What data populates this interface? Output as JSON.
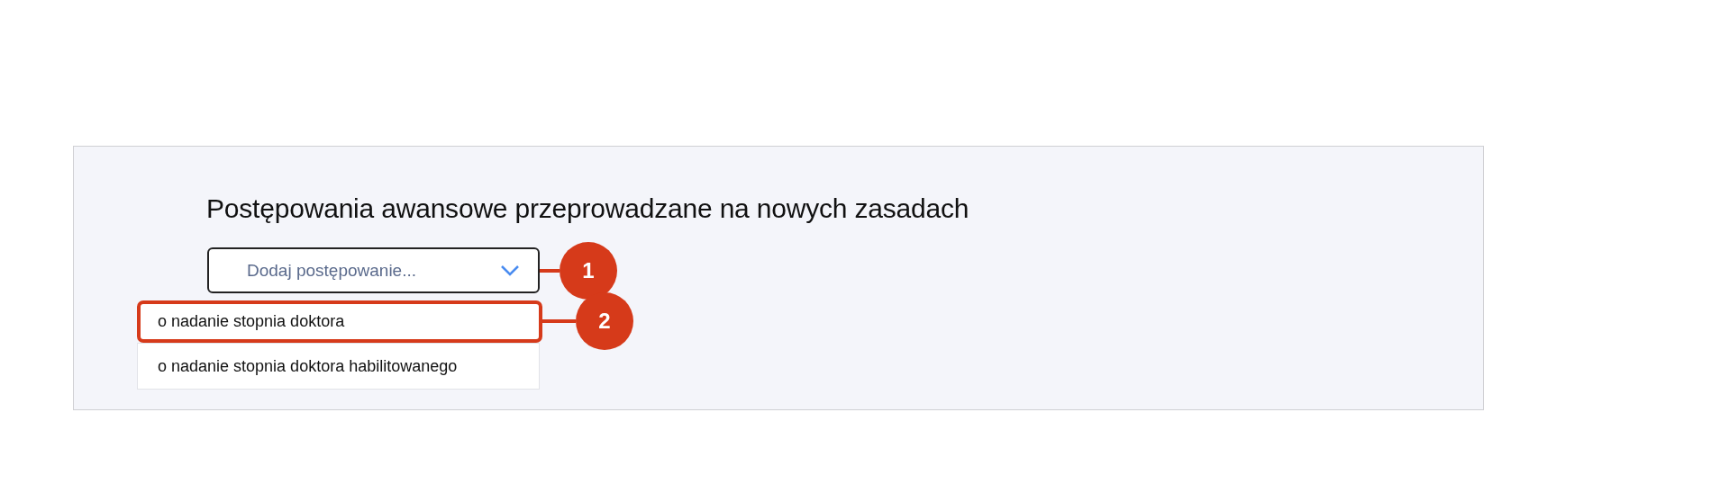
{
  "title": "Postępowania awansowe przeprowadzane na nowych zasadach",
  "dropdown": {
    "placeholder": "Dodaj postępowanie...",
    "callout": "1"
  },
  "options": [
    {
      "label": "o nadanie stopnia doktora",
      "selected": true,
      "callout": "2"
    },
    {
      "label": "o nadanie stopnia doktora habilitowanego",
      "selected": false
    }
  ]
}
